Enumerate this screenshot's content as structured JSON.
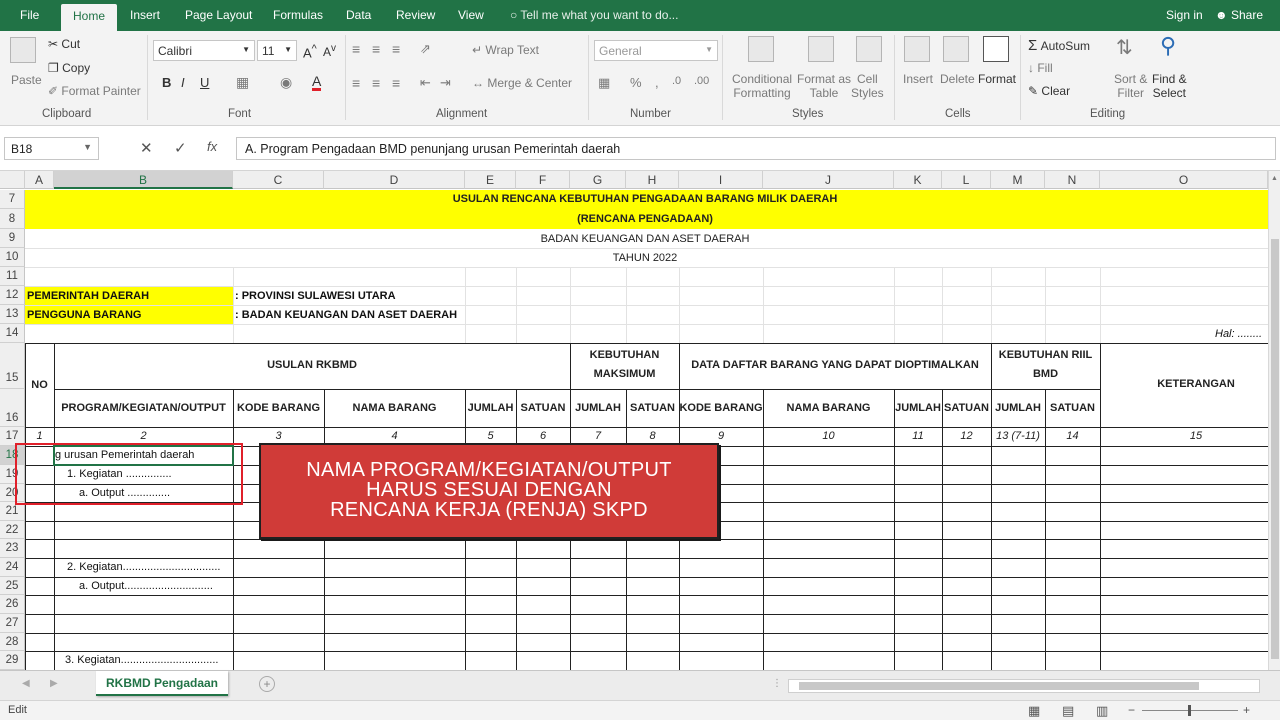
{
  "menubar": {
    "tabs": [
      "File",
      "Home",
      "Insert",
      "Page Layout",
      "Formulas",
      "Data",
      "Review",
      "View"
    ],
    "active_tab": "Home",
    "tell_me": "Tell me what you want to do...",
    "sign_in": "Sign in",
    "share": "Share"
  },
  "ribbon": {
    "clipboard": {
      "paste": "Paste",
      "cut": "Cut",
      "copy": "Copy",
      "format_painter": "Format Painter",
      "label": "Clipboard"
    },
    "font": {
      "name": "Calibri",
      "size": "11",
      "bold": "B",
      "italic": "I",
      "underline": "U",
      "label": "Font"
    },
    "alignment": {
      "wrap_text": "Wrap Text",
      "merge_center": "Merge & Center",
      "label": "Alignment"
    },
    "number": {
      "format": "General",
      "label": "Number"
    },
    "styles": {
      "conditional": "Conditional",
      "formatting": "Formatting",
      "format_as": "Format as",
      "table": "Table",
      "cell": "Cell",
      "styles_btn": "Styles",
      "label": "Styles"
    },
    "cells": {
      "insert": "Insert",
      "delete": "Delete",
      "format": "Format",
      "label": "Cells"
    },
    "editing": {
      "autosum": "AutoSum",
      "fill": "Fill",
      "clear": "Clear",
      "sort": "Sort &",
      "filter": "Filter",
      "find": "Find &",
      "select": "Select",
      "label": "Editing"
    }
  },
  "formula_bar": {
    "name_box": "B18",
    "formula": "A. Program Pengadaan BMD penunjang urusan Pemerintah daerah"
  },
  "columns": [
    "A",
    "B",
    "C",
    "D",
    "E",
    "F",
    "G",
    "H",
    "I",
    "J",
    "K",
    "L",
    "M",
    "N",
    "O"
  ],
  "rows": [
    "7",
    "8",
    "9",
    "10",
    "11",
    "12",
    "13",
    "14",
    "15",
    "16",
    "17",
    "18",
    "19",
    "20",
    "21",
    "22",
    "23",
    "24",
    "25",
    "26",
    "27",
    "28",
    "29"
  ],
  "sheet": {
    "title1": "USULAN RENCANA KEBUTUHAN PENGADAAN BARANG MILIK DAERAH",
    "title2": "(RENCANA PENGADAAN)",
    "title3": "BADAN KEUANGAN DAN ASET DAERAH",
    "title4": "TAHUN 2022",
    "pemda_label": "PEMERINTAH DAERAH",
    "pemda_value": ": PROVINSI SULAWESI UTARA",
    "pengguna_label": "PENGGUNA BARANG",
    "pengguna_value": ": BADAN KEUANGAN DAN ASET DAERAH",
    "hal": "Hal: ........",
    "headers": {
      "no": "NO",
      "usulan": "USULAN RKBMD",
      "kebutuhan_maks_1": "KEBUTUHAN",
      "kebutuhan_maks_2": "MAKSIMUM",
      "data_daftar": "DATA DAFTAR BARANG YANG DAPAT DIOPTIMALKAN",
      "kebutuhan_riil_1": "KEBUTUHAN RIIL",
      "kebutuhan_riil_2": "BMD",
      "keterangan": "KETERANGAN",
      "program": "PROGRAM/KEGIATAN/OUTPUT",
      "kode_barang": "KODE BARANG",
      "nama_barang": "NAMA BARANG",
      "jumlah": "JUMLAH",
      "satuan": "SATUAN",
      "jumlah2": "JUMLAH",
      "satuan2": "SATUAN",
      "kode_barang2": "KODE BARANG",
      "nama_barang2": "NAMA BARANG",
      "jumlah3": "JUMLAH",
      "satuan3": "SATUAN",
      "jumlah4": "JUMLAH",
      "satuan4": "SATUAN"
    },
    "index_row": [
      "1",
      "2",
      "3",
      "4",
      "5",
      "6",
      "7",
      "8",
      "9",
      "10",
      "11",
      "12",
      "13 (7-11)",
      "14",
      "15"
    ],
    "r18": "g urusan Pemerintah daerah",
    "r19": "1. Kegiatan ...............",
    "r20": "a. Output ..............",
    "r24": "2. Kegiatan................................",
    "r25": "a. Output.............................",
    "r29": "3. Kegiatan................................"
  },
  "annotation": {
    "line1": "NAMA PROGRAM/KEGIATAN/OUTPUT",
    "line2": "HARUS SESUAI DENGAN",
    "line3": "RENCANA KERJA (RENJA) SKPD"
  },
  "sheet_tab": "RKBMD Pengadaan",
  "status": "Edit",
  "colors": {
    "excel_green": "#217346",
    "highlight": "#ffff00",
    "annotation": "#d03b38"
  }
}
